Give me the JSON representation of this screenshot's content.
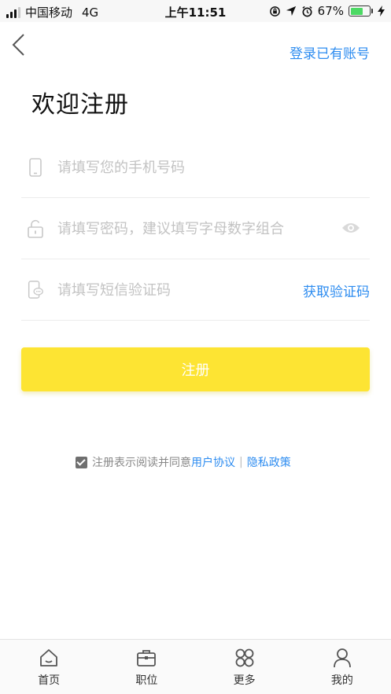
{
  "status_bar": {
    "carrier": "中国移动",
    "network": "4G",
    "time": "上午11:51",
    "battery_percent": "67%",
    "battery_level": 0.67,
    "icons": [
      "signal-icon",
      "rotation-lock-icon",
      "location-icon",
      "alarm-icon",
      "battery-icon",
      "charging-icon"
    ]
  },
  "header": {
    "login_link": "登录已有账号"
  },
  "title": "欢迎注册",
  "form": {
    "phone_placeholder": "请填写您的手机号码",
    "password_placeholder": "请填写密码，建议填写字母数字组合",
    "sms_placeholder": "请填写短信验证码",
    "sms_button": "获取验证码"
  },
  "register_button": "注册",
  "agreement": {
    "checked": true,
    "text": "注册表示阅读并同意",
    "user_agreement": "用户协议",
    "separator": "|",
    "privacy_policy": "隐私政策"
  },
  "tabs": [
    {
      "label": "首页",
      "icon": "home-icon"
    },
    {
      "label": "职位",
      "icon": "briefcase-icon"
    },
    {
      "label": "更多",
      "icon": "grid-icon"
    },
    {
      "label": "我的",
      "icon": "user-icon"
    }
  ],
  "colors": {
    "accent_blue": "#2d8cf0",
    "button_yellow": "#fde433",
    "placeholder": "#c3c3c3"
  }
}
